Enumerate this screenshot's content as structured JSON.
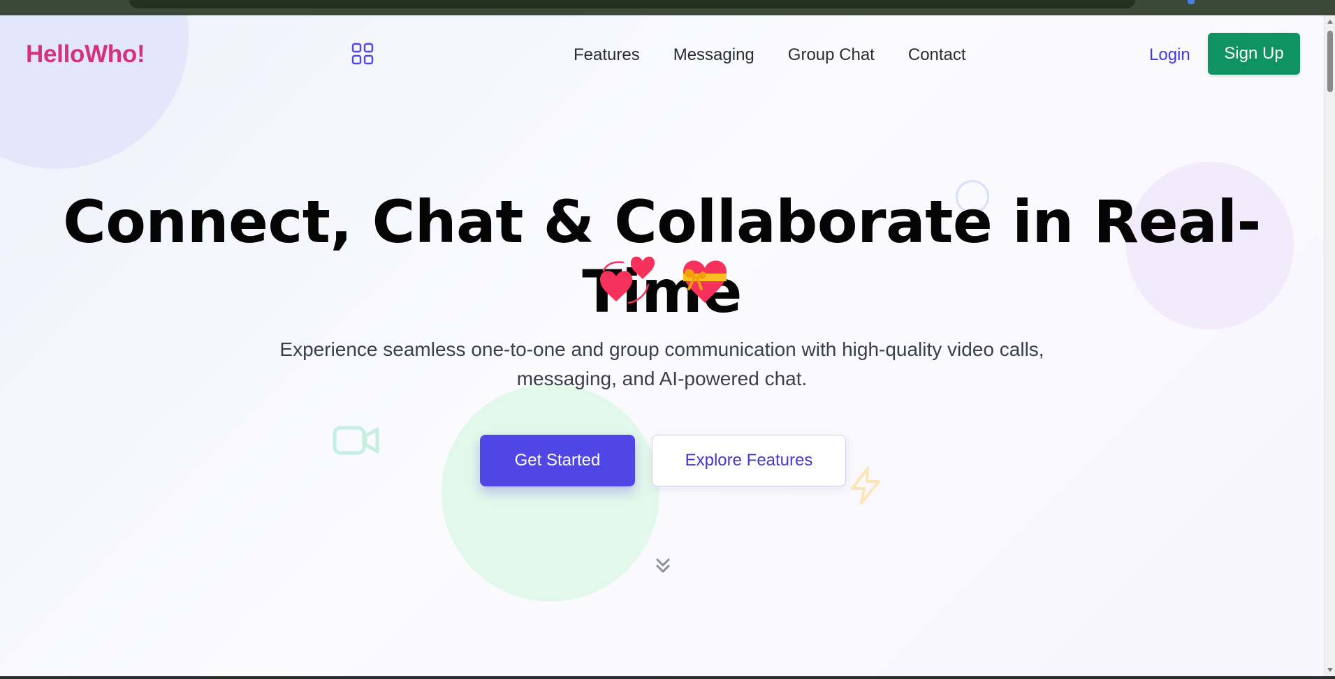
{
  "header": {
    "logo": "HelloWho!",
    "nav_links": [
      "Features",
      "Messaging",
      "Group Chat",
      "Contact"
    ],
    "login_label": "Login",
    "signup_label": "Sign Up"
  },
  "hero": {
    "title": "Connect, Chat & Collaborate in Real-Time",
    "emojis": [
      "two-hearts",
      "heart-with-ribbon"
    ],
    "subtitle": "Experience seamless one-to-one and group communication with high-quality video calls, messaging, and AI-powered chat.",
    "primary_cta": "Get Started",
    "secondary_cta": "Explore Features"
  },
  "icons": {
    "apps": "grid-icon",
    "decor_video": "video-camera-icon",
    "decor_bolt": "lightning-icon",
    "scroll": "chevrons-down-icon"
  },
  "colors": {
    "logo": "#d6317e",
    "primary": "#4f46e5",
    "signup": "#0f9363",
    "link": "#4338e0"
  }
}
